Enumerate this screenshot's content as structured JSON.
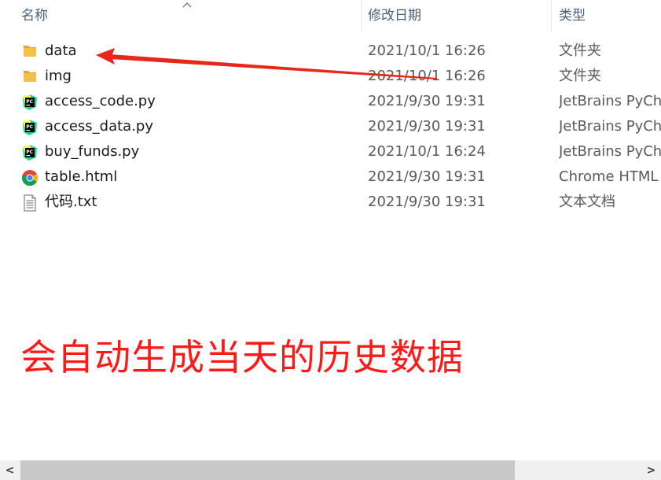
{
  "columns": {
    "name": "名称",
    "date": "修改日期",
    "type": "类型"
  },
  "files": [
    {
      "name": "data",
      "date": "2021/10/1 16:26",
      "type": "文件夹",
      "icon": "folder-icon"
    },
    {
      "name": "img",
      "date": "2021/10/1 16:26",
      "type": "文件夹",
      "icon": "folder-icon"
    },
    {
      "name": "access_code.py",
      "date": "2021/9/30 19:31",
      "type": "JetBrains PyCha",
      "icon": "pycharm-icon"
    },
    {
      "name": "access_data.py",
      "date": "2021/9/30 19:31",
      "type": "JetBrains PyCha",
      "icon": "pycharm-icon"
    },
    {
      "name": "buy_funds.py",
      "date": "2021/10/1 16:24",
      "type": "JetBrains PyCha",
      "icon": "pycharm-icon"
    },
    {
      "name": "table.html",
      "date": "2021/9/30 19:31",
      "type": "Chrome HTML",
      "icon": "chrome-icon"
    },
    {
      "name": "代码.txt",
      "date": "2021/9/30 19:31",
      "type": "文本文档",
      "icon": "text-file-icon"
    }
  ],
  "annotation": {
    "text": "会自动生成当天的历史数据",
    "color": "#ff1a1a"
  },
  "scrollbar": {
    "left_arrow": "<",
    "right_arrow": ">"
  },
  "colors": {
    "header_text": "#4c607a",
    "folder": "#f5c04a",
    "arrow": "#e8271c"
  }
}
